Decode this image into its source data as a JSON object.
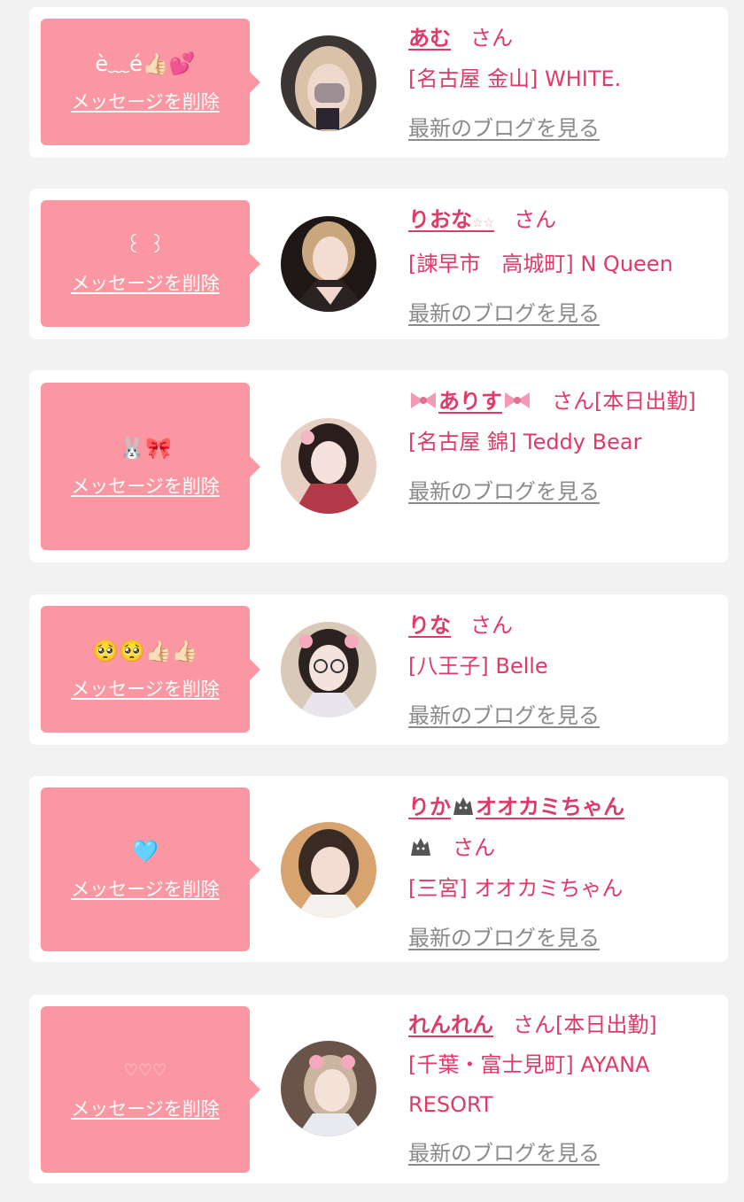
{
  "items": [
    {
      "message": "è﹏é👍🏻💕",
      "delete_label": "メッセージを削除",
      "name": "あむ",
      "honorific": "さん",
      "shop": "[名古屋 金山] WHITE.",
      "blog_label": "最新のブログを見る"
    },
    {
      "message": "꒰ ꒱",
      "delete_label": "メッセージを削除",
      "name": "りおな",
      "name_suffix": "☆☆",
      "honorific": "さん",
      "shop": "[諫早市　高城町] N Queen",
      "blog_label": "最新のブログを見る"
    },
    {
      "message": "🐰🎀",
      "delete_label": "メッセージを削除",
      "name": "ありす",
      "honorific": "さん[本日出勤]",
      "shop": "[名古屋 錦] Teddy Bear",
      "blog_label": "最新のブログを見る"
    },
    {
      "message": "🥺🥺👍🏻👍🏻",
      "delete_label": "メッセージを削除",
      "name": "りな",
      "honorific": "さん",
      "shop": "[八王子] Belle",
      "blog_label": "最新のブログを見る"
    },
    {
      "message": "🩵",
      "delete_label": "メッセージを削除",
      "name_part1": "りか",
      "name_part2": "オオカミちゃん",
      "honorific": "さん",
      "shop": "[三宮] オオカミちゃん",
      "blog_label": "最新のブログを見る"
    },
    {
      "message": "♡♡♡",
      "delete_label": "メッセージを削除",
      "name": "れんれん",
      "honorific": "さん[本日出勤]",
      "shop_line1": "[千葉・富士見町] AYANA",
      "shop_line2": "RESORT",
      "blog_label": "最新のブログを見る"
    }
  ]
}
